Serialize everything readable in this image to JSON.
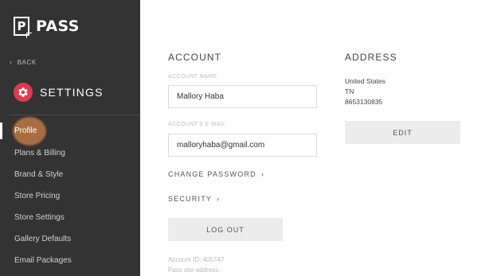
{
  "sidebar": {
    "logo_mark": "P",
    "logo_text": "PASS",
    "back_label": "BACK",
    "settings_label": "SETTINGS",
    "items": [
      {
        "label": "Profile",
        "active": true
      },
      {
        "label": "Plans & Billing"
      },
      {
        "label": "Brand & Style"
      },
      {
        "label": "Store Pricing"
      },
      {
        "label": "Store Settings"
      },
      {
        "label": "Gallery Defaults"
      },
      {
        "label": "Email Packages"
      }
    ]
  },
  "account": {
    "title": "ACCOUNT",
    "name_label": "ACCOUNT NAME",
    "name_value": "Mallory Haba",
    "email_label": "ACCOUNT'S E-MAIL",
    "email_value": "malloryhaba@gmail.com",
    "change_password": "CHANGE PASSWORD",
    "security": "SECURITY",
    "logout": "LOG OUT",
    "account_id": "Account ID: 405747",
    "pass_site": "Pass site address:"
  },
  "address": {
    "title": "ADDRESS",
    "country": "United States",
    "state": "TN",
    "phone": "8653130835",
    "edit": "EDIT"
  },
  "colors": {
    "sidebar_bg": "#333333",
    "accent": "#dd3b50"
  },
  "icons": {
    "back": "chevron-left-icon",
    "settings": "gear-icon",
    "link_arrow": "chevron-right-icon"
  }
}
